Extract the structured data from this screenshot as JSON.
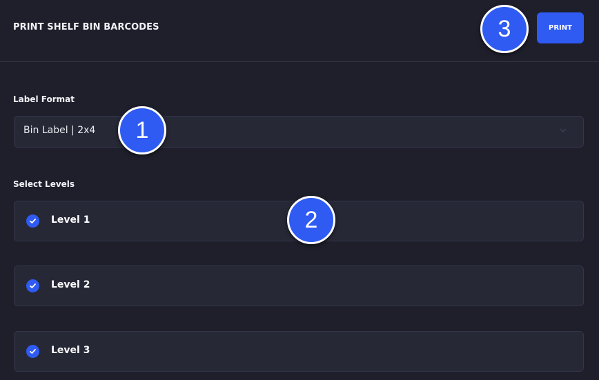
{
  "header": {
    "title": "PRINT SHELF BIN BARCODES",
    "print_label": "PRINT"
  },
  "label_format": {
    "label": "Label Format",
    "value": "Bin Label | 2x4"
  },
  "levels": {
    "label": "Select Levels",
    "items": [
      {
        "label": "Level 1",
        "checked": true
      },
      {
        "label": "Level 2",
        "checked": true
      },
      {
        "label": "Level 3",
        "checked": true
      }
    ]
  },
  "callouts": [
    "1",
    "2",
    "3"
  ],
  "colors": {
    "accent": "#2f5bf3",
    "background": "#1e1f2b",
    "surface": "#262836"
  },
  "icons": {
    "select_chevron": "chevron-down-icon",
    "level_check": "check-circle-icon"
  }
}
